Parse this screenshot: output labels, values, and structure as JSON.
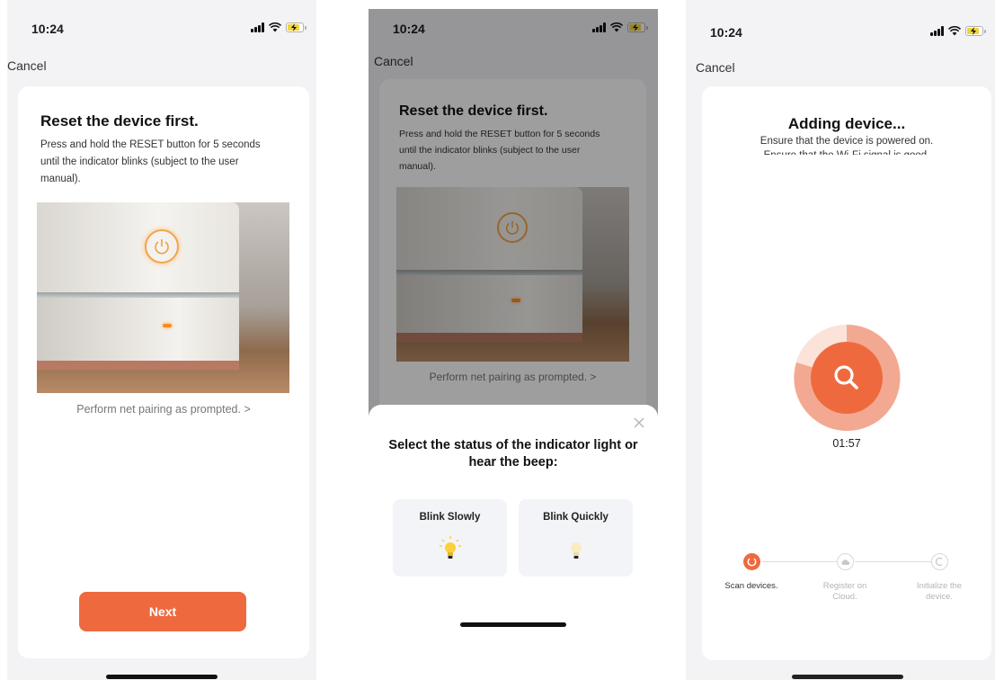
{
  "status": {
    "time": "10:24"
  },
  "common": {
    "cancel": "Cancel"
  },
  "screen1": {
    "heading": "Reset the device first.",
    "description": "Press and hold the RESET button for 5 seconds until the indicator blinks (subject to the user manual).",
    "link": "Perform net pairing as prompted. >",
    "next_label": "Next"
  },
  "screen2": {
    "heading": "Reset the device first.",
    "description": "Press and hold the RESET button for 5 seconds until the indicator blinks (subject to the user manual).",
    "link": "Perform net pairing as prompted. >",
    "sheet_title": "Select the status of the indicator light or hear the beep:",
    "options": [
      {
        "label": "Blink Slowly"
      },
      {
        "label": "Blink Quickly"
      }
    ]
  },
  "screen3": {
    "heading": "Adding device...",
    "subtitle": "Ensure that the device is powered on.",
    "subtitle2": "Ensure that the Wi-Fi signal is good.",
    "timer": "01:57",
    "steps": [
      {
        "label": "Scan devices.",
        "state": "active"
      },
      {
        "label": "Register on Cloud.",
        "state": "idle"
      },
      {
        "label": "Initialize the device.",
        "state": "idle"
      }
    ]
  },
  "colors": {
    "accent": "#ee6a3e",
    "battery": "#f2d33c",
    "background": "#f3f3f5"
  },
  "icons": [
    "signal-icon",
    "wifi-icon",
    "battery-charging-icon",
    "power-icon",
    "close-icon",
    "bulb-icon",
    "search-icon",
    "loading-icon",
    "cloud-icon",
    "initialize-icon"
  ]
}
